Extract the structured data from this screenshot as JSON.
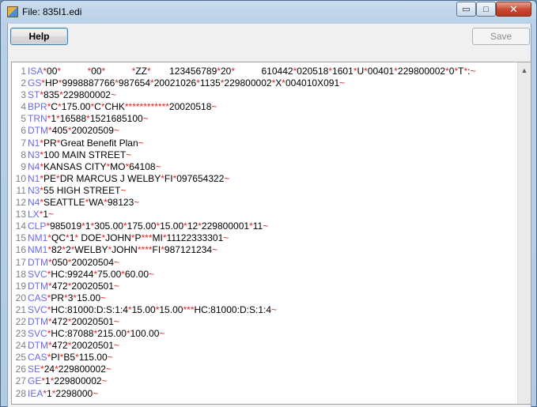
{
  "window": {
    "title": "File: 835I1.edi",
    "min_label": "▭",
    "max_label": "□",
    "close_label": "✕"
  },
  "toolbar": {
    "help_label": "Help",
    "save_label": "Save"
  },
  "editor": {
    "lines": [
      {
        "n": "1",
        "seg": "ISA",
        "rest": "*00*          *00*          *ZZ*       123456789*20*          610442*020518*1601*U*00401*229800002*0*T*:~"
      },
      {
        "n": "2",
        "seg": "GS",
        "rest": "*HP*9998887766*987654*20021026*1135*229800002*X*004010X091~"
      },
      {
        "n": "3",
        "seg": "ST",
        "rest": "*835*229800002~"
      },
      {
        "n": "4",
        "seg": "BPR",
        "rest": "*C*175.00*C*CHK************20020518~"
      },
      {
        "n": "5",
        "seg": "TRN",
        "rest": "*1*16588*1521685100~"
      },
      {
        "n": "6",
        "seg": "DTM",
        "rest": "*405*20020509~"
      },
      {
        "n": "7",
        "seg": "N1",
        "rest": "*PR*Great Benefit Plan~"
      },
      {
        "n": "8",
        "seg": "N3",
        "rest": "*100 MAIN STREET~"
      },
      {
        "n": "9",
        "seg": "N4",
        "rest": "*KANSAS CITY*MO*64108~"
      },
      {
        "n": "10",
        "seg": "N1",
        "rest": "*PE*DR MARCUS J WELBY*FI*097654322~"
      },
      {
        "n": "11",
        "seg": "N3",
        "rest": "*55 HIGH STREET~"
      },
      {
        "n": "12",
        "seg": "N4",
        "rest": "*SEATTLE*WA*98123~"
      },
      {
        "n": "13",
        "seg": "LX",
        "rest": "*1~"
      },
      {
        "n": "14",
        "seg": "CLP",
        "rest": "*985019*1*305.00*175.00*15.00*12*229800001*11~"
      },
      {
        "n": "15",
        "seg": "NM1",
        "rest": "*QC*1* DOE*JOHN*P***MI*11122333301~"
      },
      {
        "n": "16",
        "seg": "NM1",
        "rest": "*82*2*WELBY*JOHN****FI*987121234~"
      },
      {
        "n": "17",
        "seg": "DTM",
        "rest": "*050*20020504~"
      },
      {
        "n": "18",
        "seg": "SVC",
        "rest": "*HC:99244*75.00*60.00~"
      },
      {
        "n": "19",
        "seg": "DTM",
        "rest": "*472*20020501~"
      },
      {
        "n": "20",
        "seg": "CAS",
        "rest": "*PR*3*15.00~"
      },
      {
        "n": "21",
        "seg": "SVC",
        "rest": "*HC:81000:D:S:1:4*15.00*15.00***HC:81000:D:S:1:4~"
      },
      {
        "n": "22",
        "seg": "DTM",
        "rest": "*472*20020501~"
      },
      {
        "n": "23",
        "seg": "SVC",
        "rest": "*HC:87088*215.00*100.00~"
      },
      {
        "n": "24",
        "seg": "DTM",
        "rest": "*472*20020501~"
      },
      {
        "n": "25",
        "seg": "CAS",
        "rest": "*PI*B5*115.00~"
      },
      {
        "n": "26",
        "seg": "SE",
        "rest": "*24*229800002~"
      },
      {
        "n": "27",
        "seg": "GE",
        "rest": "*1*229800002~"
      },
      {
        "n": "28",
        "seg": "IEA",
        "rest": "*1*2298000~"
      }
    ]
  },
  "colors": {
    "segment": "#6969e8",
    "separator": "#e02424",
    "line_number": "#7f7f7f"
  }
}
